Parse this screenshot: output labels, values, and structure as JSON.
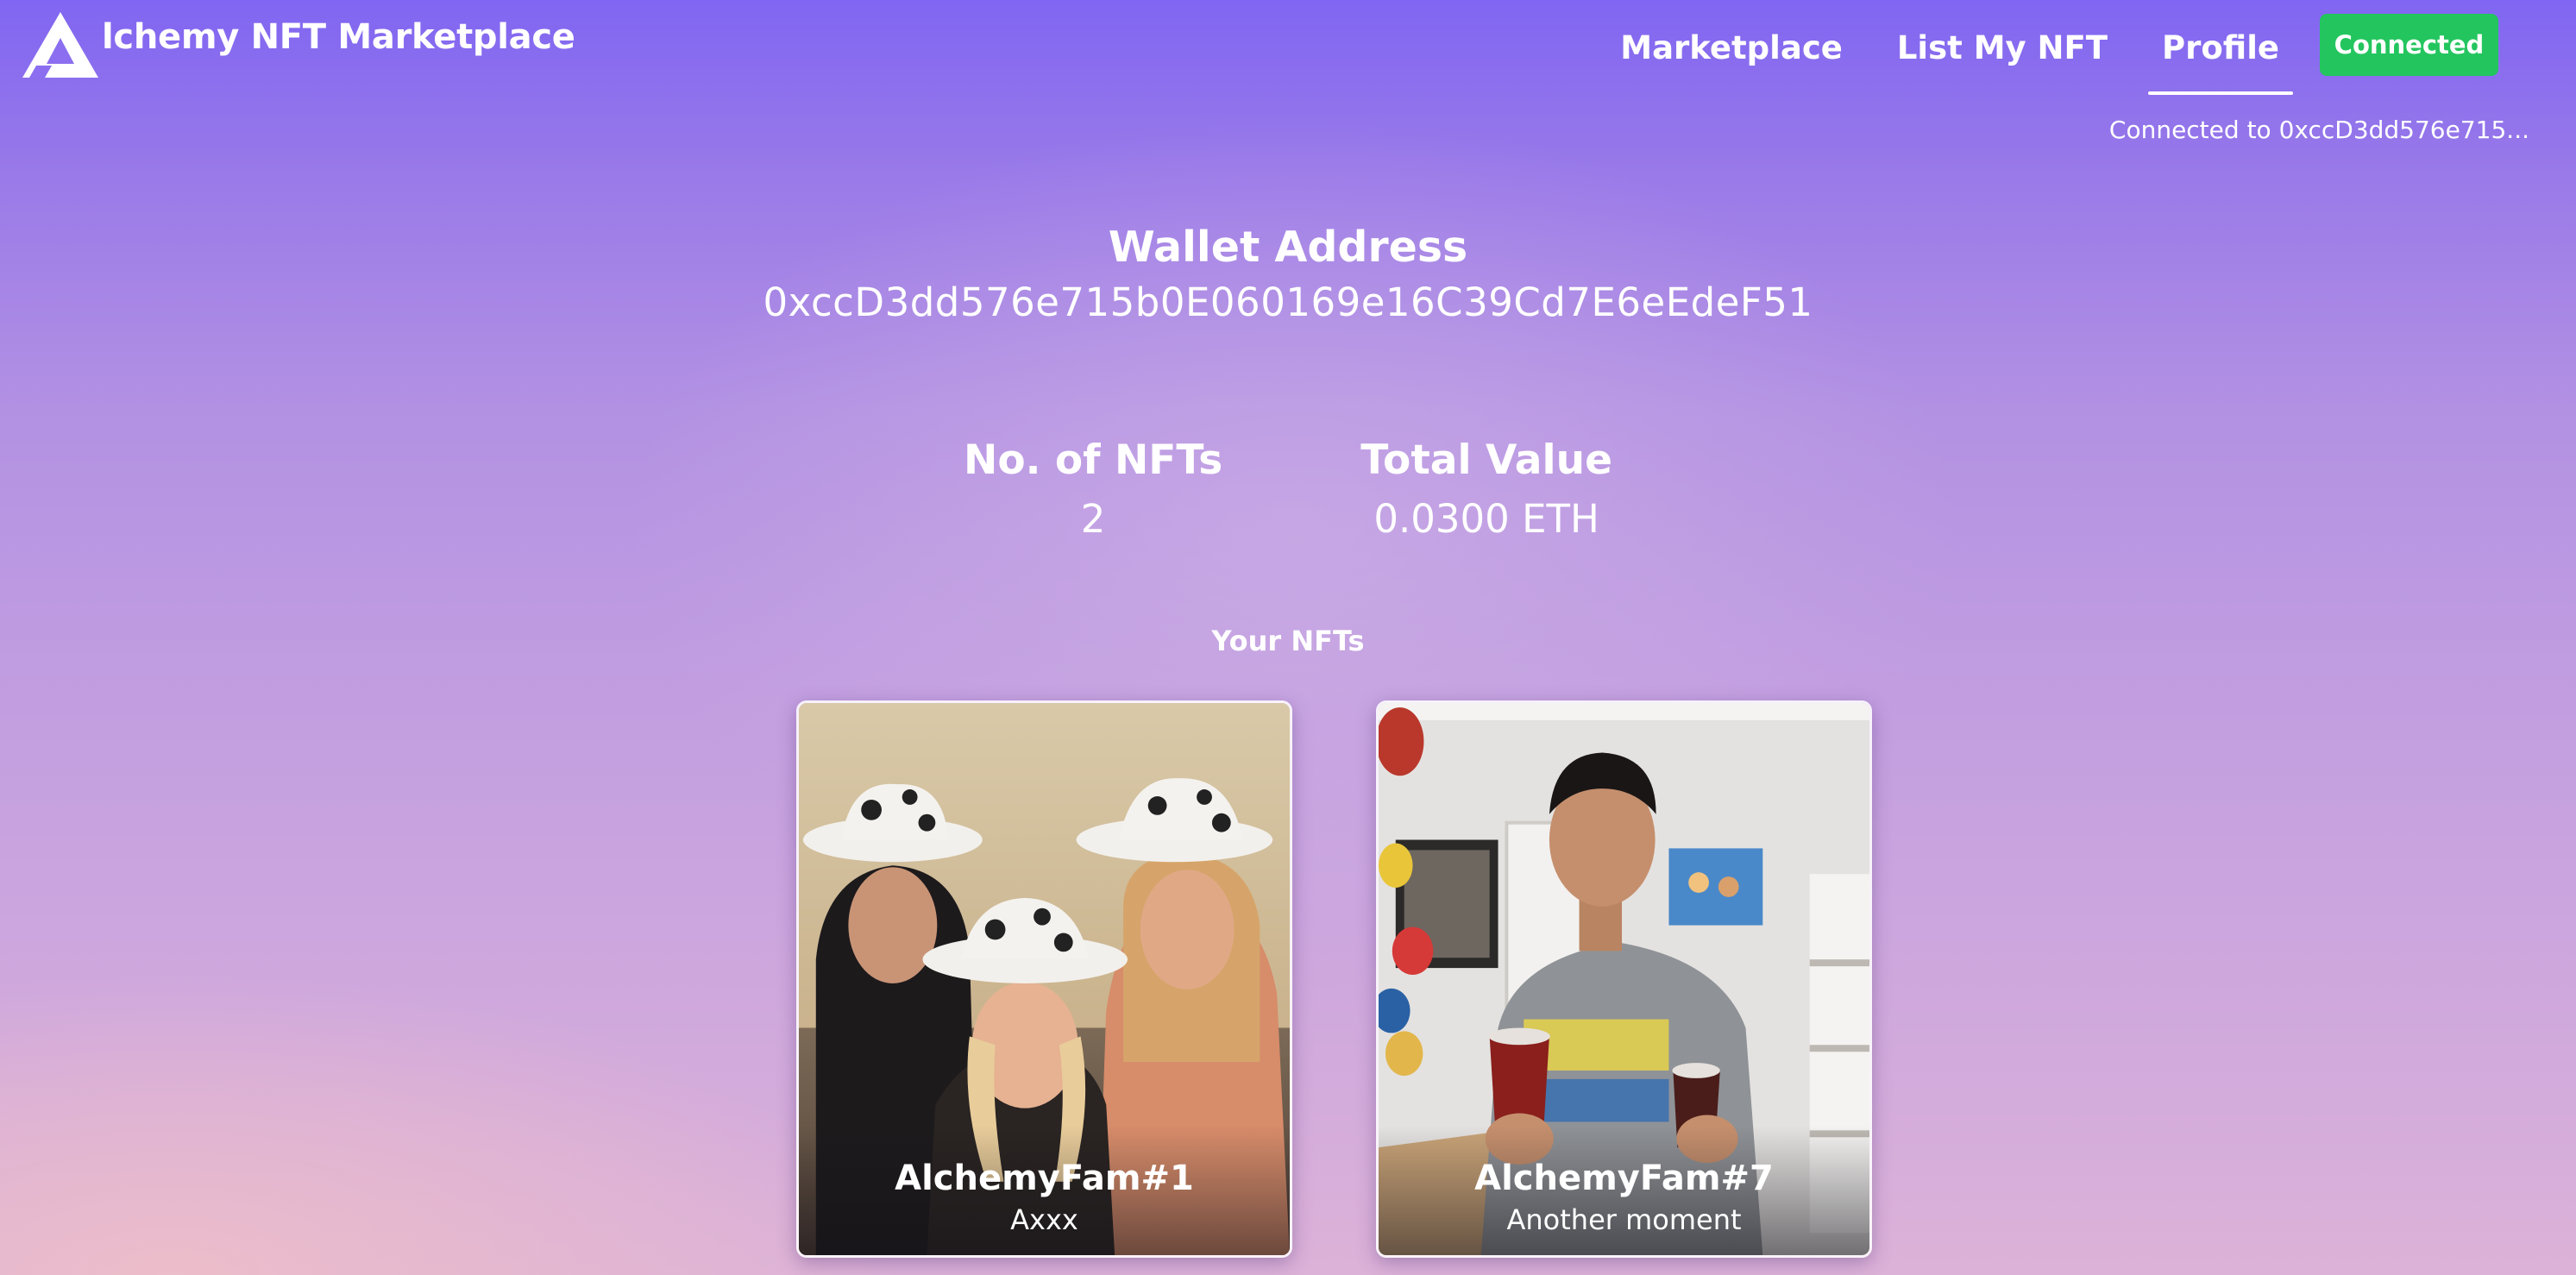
{
  "header": {
    "brand_name": "lchemy NFT Marketplace",
    "nav": [
      {
        "label": "Marketplace",
        "active": false
      },
      {
        "label": "List My NFT",
        "active": false
      },
      {
        "label": "Profile",
        "active": true
      }
    ],
    "connect_button_label": "Connected",
    "connected_text": "Connected to 0xccD3dd576e715..."
  },
  "profile": {
    "wallet_title": "Wallet Address",
    "wallet_address": "0xccD3dd576e715b0E060169e16C39Cd7E6eEdeF51",
    "stats": [
      {
        "title": "No. of NFTs",
        "value": "2"
      },
      {
        "title": "Total Value",
        "value": "0.0300 ETH"
      }
    ],
    "section_title": "Your NFTs"
  },
  "nfts": [
    {
      "name": "AlchemyFam#1",
      "description": "Axxx",
      "image": "group-photo-cowboy-hats"
    },
    {
      "name": "AlchemyFam#7",
      "description": "Another moment",
      "image": "man-holding-drinks"
    }
  ],
  "colors": {
    "background_top": "#8066f2",
    "background_bottom": "#dcb2d8",
    "connected_button": "#23c55e",
    "text": "#ffffff"
  },
  "icons": {
    "logo": "alchemy-logo-icon"
  }
}
